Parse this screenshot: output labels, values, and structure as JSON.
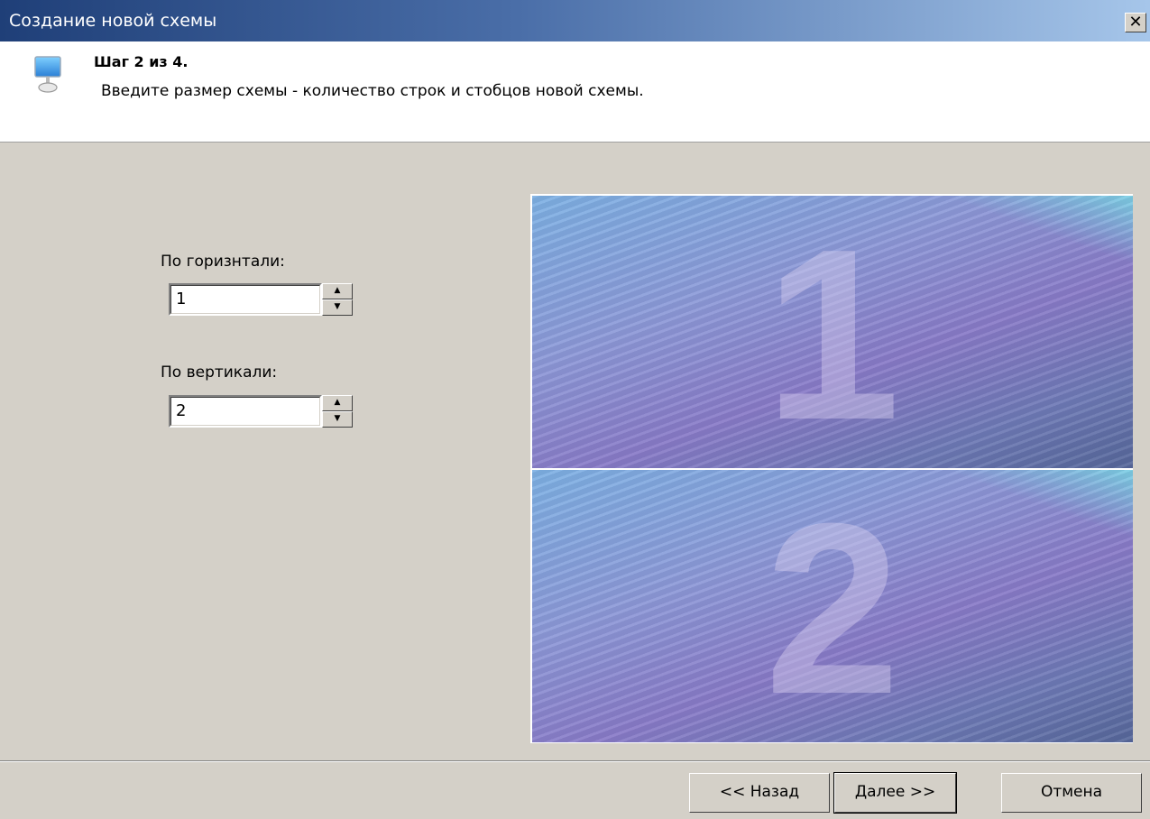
{
  "window": {
    "title": "Создание новой схемы",
    "close_glyph": "✕"
  },
  "header": {
    "icon": "monitor-icon",
    "step": "Шаг 2 из 4.",
    "description": "Введите размер схемы - количество строк и стобцов новой схемы."
  },
  "form": {
    "horizontal": {
      "label": "По горизнтали:",
      "value": "1"
    },
    "vertical": {
      "label": "По вертикали:",
      "value": "2"
    },
    "spin_up_glyph": "▲",
    "spin_down_glyph": "▼"
  },
  "preview": {
    "panes": [
      "1",
      "2"
    ]
  },
  "buttons": {
    "back": "<< Назад",
    "next": "Далее >>",
    "cancel": "Отмена"
  },
  "colors": {
    "titlebar_start": "#1f3f78",
    "titlebar_end": "#a6c6ea",
    "dialog_bg": "#d4d0c8"
  }
}
